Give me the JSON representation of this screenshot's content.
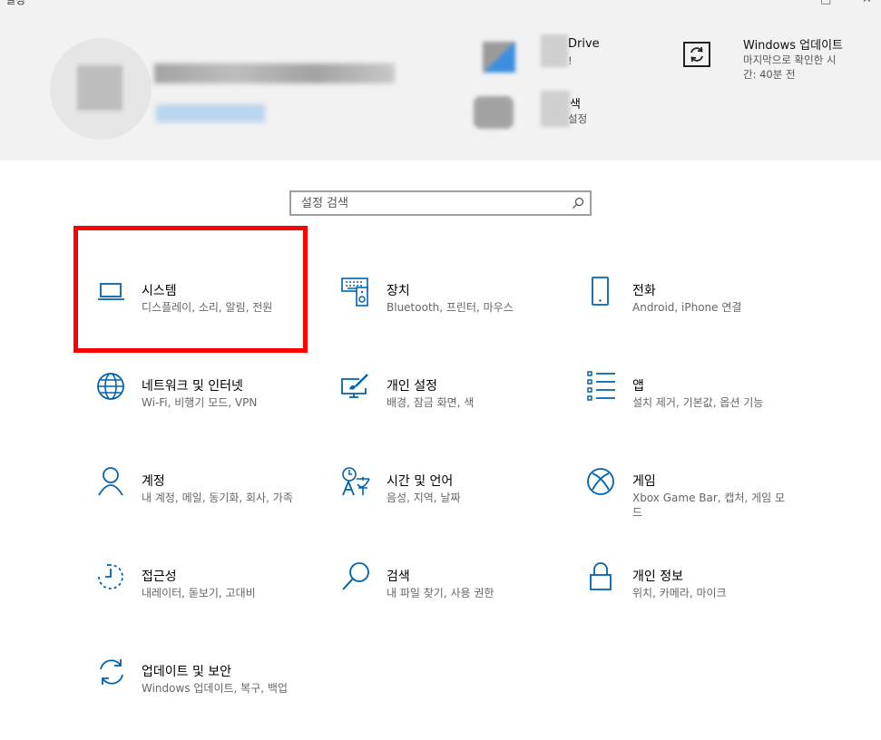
{
  "window": {
    "title": "설정"
  },
  "header": {
    "onedrive": {
      "title": "Drive",
      "sub": "!"
    },
    "search_item": {
      "title": "색",
      "sub": "설정"
    },
    "windows_update": {
      "title": "Windows 업데이트",
      "sub_line1": "마지막으로 확인한 시",
      "sub_line2": "간: 40분 전"
    }
  },
  "search": {
    "placeholder": "설정 검색"
  },
  "tiles": [
    {
      "title": "시스템",
      "desc": "디스플레이, 소리, 알림, 전원"
    },
    {
      "title": "장치",
      "desc": "Bluetooth, 프린터, 마우스"
    },
    {
      "title": "전화",
      "desc": "Android, iPhone 연결"
    },
    {
      "title": "네트워크 및 인터넷",
      "desc": "Wi-Fi, 비행기 모드, VPN"
    },
    {
      "title": "개인 설정",
      "desc": "배경, 잠금 화면, 색"
    },
    {
      "title": "앱",
      "desc": "설치 제거, 기본값, 옵션 기능"
    },
    {
      "title": "계정",
      "desc": "내 계정, 메일, 동기화, 회사, 가족"
    },
    {
      "title": "시간 및 언어",
      "desc": "음성, 지역, 날짜"
    },
    {
      "title": "게임",
      "desc": "Xbox Game Bar, 캡처, 게임 모드"
    },
    {
      "title": "접근성",
      "desc": "내레이터, 돋보기, 고대비"
    },
    {
      "title": "검색",
      "desc": "내 파일 찾기, 사용 권한"
    },
    {
      "title": "개인 정보",
      "desc": "위치, 카메라, 마이크"
    },
    {
      "title": "업데이트 및 보안",
      "desc": "Windows 업데이트, 복구, 백업"
    }
  ],
  "colors": {
    "accent": "#0063b1",
    "highlight": "#ff0000",
    "header_bg": "#f2f2f2"
  }
}
